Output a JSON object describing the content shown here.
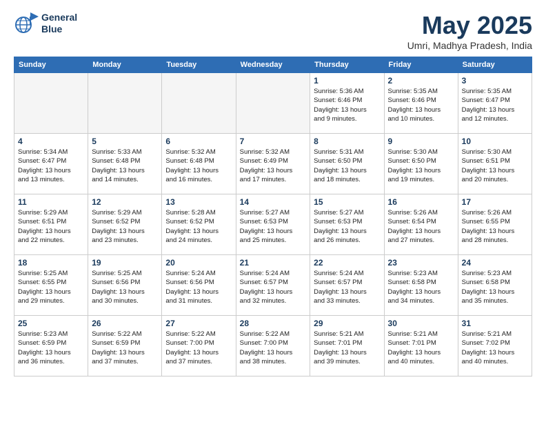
{
  "header": {
    "logo_line1": "General",
    "logo_line2": "Blue",
    "month": "May 2025",
    "location": "Umri, Madhya Pradesh, India"
  },
  "weekdays": [
    "Sunday",
    "Monday",
    "Tuesday",
    "Wednesday",
    "Thursday",
    "Friday",
    "Saturday"
  ],
  "weeks": [
    [
      {
        "day": "",
        "info": ""
      },
      {
        "day": "",
        "info": ""
      },
      {
        "day": "",
        "info": ""
      },
      {
        "day": "",
        "info": ""
      },
      {
        "day": "1",
        "info": "Sunrise: 5:36 AM\nSunset: 6:46 PM\nDaylight: 13 hours\nand 9 minutes."
      },
      {
        "day": "2",
        "info": "Sunrise: 5:35 AM\nSunset: 6:46 PM\nDaylight: 13 hours\nand 10 minutes."
      },
      {
        "day": "3",
        "info": "Sunrise: 5:35 AM\nSunset: 6:47 PM\nDaylight: 13 hours\nand 12 minutes."
      }
    ],
    [
      {
        "day": "4",
        "info": "Sunrise: 5:34 AM\nSunset: 6:47 PM\nDaylight: 13 hours\nand 13 minutes."
      },
      {
        "day": "5",
        "info": "Sunrise: 5:33 AM\nSunset: 6:48 PM\nDaylight: 13 hours\nand 14 minutes."
      },
      {
        "day": "6",
        "info": "Sunrise: 5:32 AM\nSunset: 6:48 PM\nDaylight: 13 hours\nand 16 minutes."
      },
      {
        "day": "7",
        "info": "Sunrise: 5:32 AM\nSunset: 6:49 PM\nDaylight: 13 hours\nand 17 minutes."
      },
      {
        "day": "8",
        "info": "Sunrise: 5:31 AM\nSunset: 6:50 PM\nDaylight: 13 hours\nand 18 minutes."
      },
      {
        "day": "9",
        "info": "Sunrise: 5:30 AM\nSunset: 6:50 PM\nDaylight: 13 hours\nand 19 minutes."
      },
      {
        "day": "10",
        "info": "Sunrise: 5:30 AM\nSunset: 6:51 PM\nDaylight: 13 hours\nand 20 minutes."
      }
    ],
    [
      {
        "day": "11",
        "info": "Sunrise: 5:29 AM\nSunset: 6:51 PM\nDaylight: 13 hours\nand 22 minutes."
      },
      {
        "day": "12",
        "info": "Sunrise: 5:29 AM\nSunset: 6:52 PM\nDaylight: 13 hours\nand 23 minutes."
      },
      {
        "day": "13",
        "info": "Sunrise: 5:28 AM\nSunset: 6:52 PM\nDaylight: 13 hours\nand 24 minutes."
      },
      {
        "day": "14",
        "info": "Sunrise: 5:27 AM\nSunset: 6:53 PM\nDaylight: 13 hours\nand 25 minutes."
      },
      {
        "day": "15",
        "info": "Sunrise: 5:27 AM\nSunset: 6:53 PM\nDaylight: 13 hours\nand 26 minutes."
      },
      {
        "day": "16",
        "info": "Sunrise: 5:26 AM\nSunset: 6:54 PM\nDaylight: 13 hours\nand 27 minutes."
      },
      {
        "day": "17",
        "info": "Sunrise: 5:26 AM\nSunset: 6:55 PM\nDaylight: 13 hours\nand 28 minutes."
      }
    ],
    [
      {
        "day": "18",
        "info": "Sunrise: 5:25 AM\nSunset: 6:55 PM\nDaylight: 13 hours\nand 29 minutes."
      },
      {
        "day": "19",
        "info": "Sunrise: 5:25 AM\nSunset: 6:56 PM\nDaylight: 13 hours\nand 30 minutes."
      },
      {
        "day": "20",
        "info": "Sunrise: 5:24 AM\nSunset: 6:56 PM\nDaylight: 13 hours\nand 31 minutes."
      },
      {
        "day": "21",
        "info": "Sunrise: 5:24 AM\nSunset: 6:57 PM\nDaylight: 13 hours\nand 32 minutes."
      },
      {
        "day": "22",
        "info": "Sunrise: 5:24 AM\nSunset: 6:57 PM\nDaylight: 13 hours\nand 33 minutes."
      },
      {
        "day": "23",
        "info": "Sunrise: 5:23 AM\nSunset: 6:58 PM\nDaylight: 13 hours\nand 34 minutes."
      },
      {
        "day": "24",
        "info": "Sunrise: 5:23 AM\nSunset: 6:58 PM\nDaylight: 13 hours\nand 35 minutes."
      }
    ],
    [
      {
        "day": "25",
        "info": "Sunrise: 5:23 AM\nSunset: 6:59 PM\nDaylight: 13 hours\nand 36 minutes."
      },
      {
        "day": "26",
        "info": "Sunrise: 5:22 AM\nSunset: 6:59 PM\nDaylight: 13 hours\nand 37 minutes."
      },
      {
        "day": "27",
        "info": "Sunrise: 5:22 AM\nSunset: 7:00 PM\nDaylight: 13 hours\nand 37 minutes."
      },
      {
        "day": "28",
        "info": "Sunrise: 5:22 AM\nSunset: 7:00 PM\nDaylight: 13 hours\nand 38 minutes."
      },
      {
        "day": "29",
        "info": "Sunrise: 5:21 AM\nSunset: 7:01 PM\nDaylight: 13 hours\nand 39 minutes."
      },
      {
        "day": "30",
        "info": "Sunrise: 5:21 AM\nSunset: 7:01 PM\nDaylight: 13 hours\nand 40 minutes."
      },
      {
        "day": "31",
        "info": "Sunrise: 5:21 AM\nSunset: 7:02 PM\nDaylight: 13 hours\nand 40 minutes."
      }
    ]
  ]
}
